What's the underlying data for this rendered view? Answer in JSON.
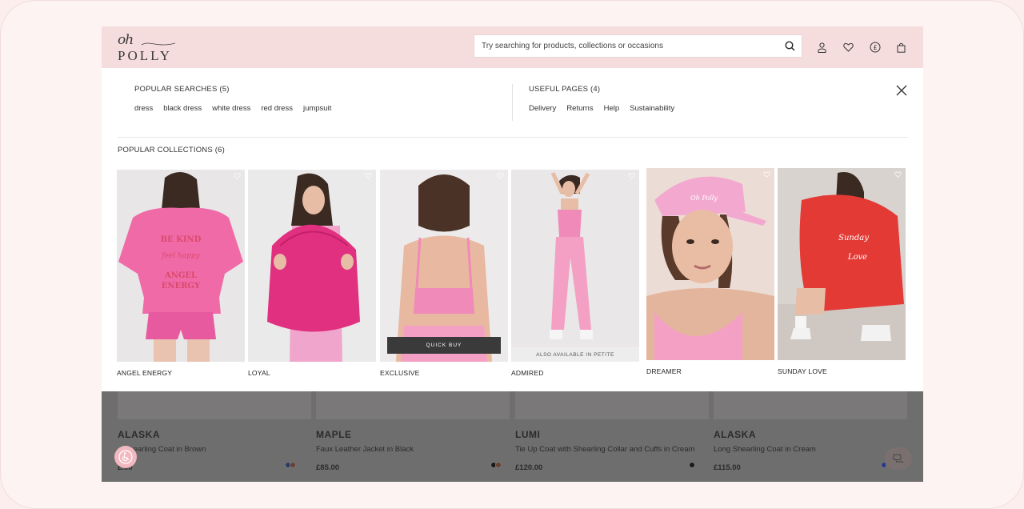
{
  "brand": {
    "top": "oh",
    "bottom": "POLLY"
  },
  "search": {
    "placeholder": "Try searching for products, collections or occasions"
  },
  "popular_searches": {
    "title": "POPULAR SEARCHES (5)",
    "items": [
      "dress",
      "black dress",
      "white dress",
      "red dress",
      "jumpsuit"
    ]
  },
  "useful_pages": {
    "title": "USEFUL PAGES (4)",
    "items": [
      "Delivery",
      "Returns",
      "Help",
      "Sustainability"
    ]
  },
  "collections": {
    "title": "POPULAR COLLECTIONS (6)",
    "items": [
      {
        "label": "ANGEL ENERGY"
      },
      {
        "label": "LOYAL"
      },
      {
        "label": "EXCLUSIVE",
        "overlay": "QUICK BUY"
      },
      {
        "label": "ADMIRED",
        "overlay": "ALSO AVAILABLE IN PETITE"
      },
      {
        "label": "DREAMER"
      },
      {
        "label": "SUNDAY LOVE"
      }
    ]
  },
  "products": [
    {
      "name": "ALASKA",
      "desc": "Shearling Coat in Brown",
      "price": "£.00"
    },
    {
      "name": "MAPLE",
      "desc": "Faux Leather Jacket in Black",
      "price": "£85.00"
    },
    {
      "name": "LUMI",
      "desc": "Tie Up Coat with Shearling Collar and Cuffs in Cream",
      "price": "£120.00"
    },
    {
      "name": "ALASKA",
      "desc": "Long Shearling Coat in Cream",
      "price": "£115.00"
    }
  ],
  "icons": {
    "search": "search-icon",
    "account": "user-icon",
    "wishlist": "heart-icon",
    "currency": "pound-icon",
    "bag": "bag-icon",
    "close": "close-icon",
    "accessibility": "accessibility-icon",
    "chat": "chat-icon"
  },
  "colors": {
    "header_bg": "#f6dddd",
    "page_bg": "#fcf3f2",
    "accent_pink": "#f08ab8",
    "overlay_gray": "#6e6e6e"
  }
}
